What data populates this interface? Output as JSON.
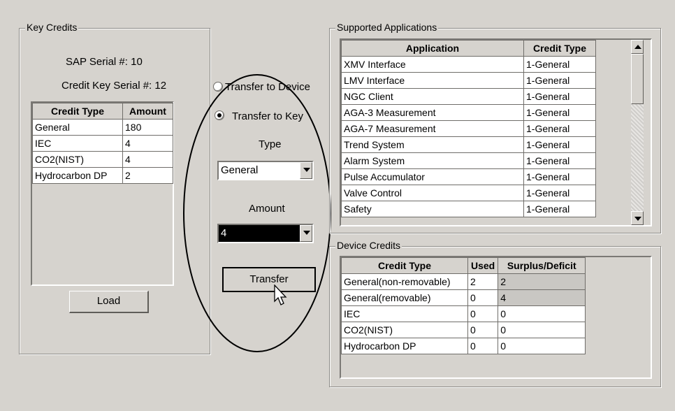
{
  "key_credits": {
    "title": "Key Credits",
    "sap_serial": "SAP Serial #: 10",
    "credit_key_serial": "Credit Key Serial #: 12",
    "headers": [
      "Credit Type",
      "Amount"
    ],
    "rows": [
      [
        "General",
        "180"
      ],
      [
        "IEC",
        "4"
      ],
      [
        "CO2(NIST)",
        "4"
      ],
      [
        "Hydrocarbon DP",
        "2"
      ]
    ],
    "load_label": "Load"
  },
  "transfer": {
    "to_device_label": "Transfer to Device",
    "to_key_label": "Transfer to Key",
    "selected": "Transfer to Key",
    "type_label": "Type",
    "type_value": "General",
    "amount_label": "Amount",
    "amount_value": "4",
    "transfer_label": "Transfer"
  },
  "supported_apps": {
    "title": "Supported Applications",
    "headers": [
      "Application",
      "Credit Type"
    ],
    "rows": [
      [
        "XMV Interface",
        "1-General"
      ],
      [
        "LMV Interface",
        "1-General"
      ],
      [
        "NGC Client",
        "1-General"
      ],
      [
        "AGA-3 Measurement",
        "1-General"
      ],
      [
        "AGA-7 Measurement",
        "1-General"
      ],
      [
        "Trend System",
        "1-General"
      ],
      [
        "Alarm System",
        "1-General"
      ],
      [
        "Pulse Accumulator",
        "1-General"
      ],
      [
        "Valve Control",
        "1-General"
      ],
      [
        "Safety",
        "1-General"
      ]
    ]
  },
  "device_credits": {
    "title": "Device Credits",
    "headers": [
      "Credit Type",
      "Used",
      "Surplus/Deficit"
    ],
    "rows": [
      [
        "General(non-removable)",
        "2",
        "2"
      ],
      [
        "General(removable)",
        "0",
        "4"
      ],
      [
        "IEC",
        "0",
        "0"
      ],
      [
        "CO2(NIST)",
        "0",
        "0"
      ],
      [
        "Hydrocarbon DP",
        "0",
        "0"
      ]
    ]
  },
  "colors": {
    "window_bg": "#d6d3ce",
    "selected_combo_bg": "#000000",
    "shaded_cell": "#c9c7c3"
  }
}
